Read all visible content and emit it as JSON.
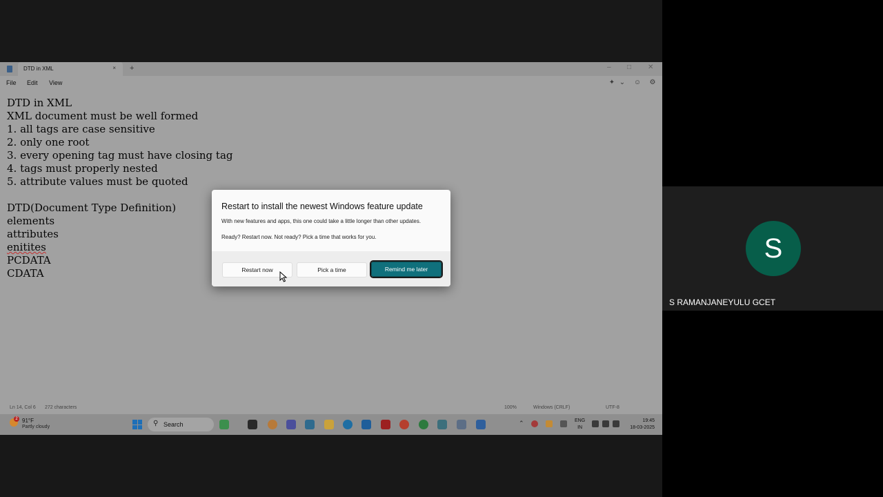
{
  "notepad": {
    "tab_title": "DTD in XML",
    "tab_close": "×",
    "new_tab": "+",
    "menu": [
      "File",
      "Edit",
      "View"
    ],
    "lines": [
      "DTD in XML",
      "XML document must be well formed",
      "1. all tags are case sensitive",
      "2. only one root",
      "3. every opening tag must have closing tag",
      "4. tags must properly nested",
      "5. attribute values must be quoted",
      "",
      "DTD(Document Type Definition)",
      "elements",
      "attributes",
      "enitites",
      "PCDATA",
      "CDATA"
    ],
    "status": {
      "position": "Ln 14, Col 6",
      "characters": "272 characters",
      "zoom": "100%",
      "line_ending": "Windows (CRLF)",
      "encoding": "UTF-8"
    }
  },
  "dialog": {
    "title": "Restart to install the newest Windows feature update",
    "body1": "With new features and apps, this one could take a little longer than other updates.",
    "body2": "Ready? Restart now. Not ready? Pick a time that works for you.",
    "restart_label": "Restart now",
    "pick_label": "Pick a time",
    "later_label": "Remind me later"
  },
  "taskbar": {
    "weather_temp": "91°F",
    "weather_desc": "Partly cloudy",
    "weather_badge": "2",
    "search_placeholder": "Search",
    "lang_line1": "ENG",
    "lang_line2": "IN",
    "time": "19:45",
    "date": "18-03-2025"
  },
  "participant": {
    "initial": "S",
    "name": "S RAMANJANEYULU GCET",
    "avatar_color": "#075e4a"
  }
}
